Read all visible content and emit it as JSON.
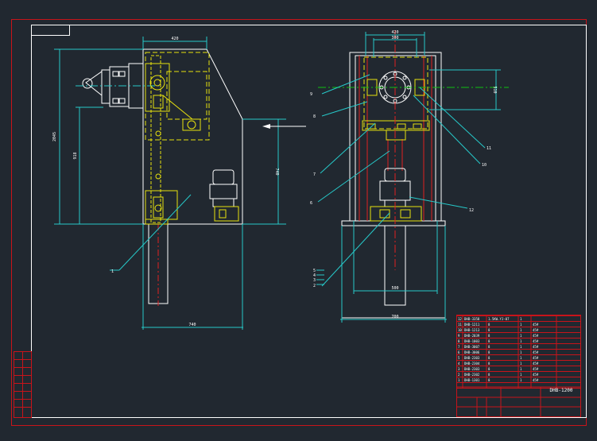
{
  "colors": {
    "background": "#212830",
    "frame": "#c8141a",
    "white": "#ffffff",
    "yellow": "#e8e20e",
    "cyan": "#26c9c9",
    "green": "#10c010",
    "red": "#e02020",
    "magenta": "#e020e0"
  },
  "side_view": {
    "dimensions": {
      "top_width": "420",
      "bottom_width": "740",
      "total_height": "2045",
      "lower_height": "918",
      "right_height": "740"
    },
    "callouts": [
      "1"
    ]
  },
  "front_view": {
    "dimensions": {
      "top_outer": "420",
      "top_inner": "300",
      "bottom_inner": "500",
      "bottom_outer": "700",
      "right_height": "510"
    },
    "callouts_left": [
      "9",
      "8",
      "7",
      "6",
      "5",
      "4",
      "3",
      "2"
    ],
    "callouts_right": [
      "11",
      "10",
      "12"
    ]
  },
  "parts_table": {
    "rows": [
      {
        "no": "12",
        "code": "DHB-3358",
        "name": "1.5KW.YJ-07",
        "qty": "1",
        "mat": ""
      },
      {
        "no": "11",
        "code": "DHB-1211",
        "name": "8",
        "qty": "1",
        "mat": "45#"
      },
      {
        "no": "10",
        "code": "DHB-1213",
        "name": "8",
        "qty": "1",
        "mat": "45#"
      },
      {
        "no": "9",
        "code": "DHB-2039",
        "name": "8",
        "qty": "1",
        "mat": "45#"
      },
      {
        "no": "8",
        "code": "DHB-1003",
        "name": "8",
        "qty": "1",
        "mat": "45#"
      },
      {
        "no": "7",
        "code": "DHB-3007",
        "name": "8",
        "qty": "1",
        "mat": "45#"
      },
      {
        "no": "6",
        "code": "DHB-3006",
        "name": "8",
        "qty": "1",
        "mat": "45#"
      },
      {
        "no": "5",
        "code": "DHB-2303",
        "name": "8",
        "qty": "1",
        "mat": "45#"
      },
      {
        "no": "4",
        "code": "DHB-2304",
        "name": "8",
        "qty": "1",
        "mat": "45#"
      },
      {
        "no": "3",
        "code": "DHB-2303",
        "name": "8",
        "qty": "1",
        "mat": "45#"
      },
      {
        "no": "2",
        "code": "DHB-2302",
        "name": "8",
        "qty": "1",
        "mat": "45#"
      },
      {
        "no": "1",
        "code": "DHB-1301",
        "name": "8",
        "qty": "1",
        "mat": "45#"
      }
    ],
    "drawing_no": "DHB-1200",
    "assembly_title": ""
  }
}
